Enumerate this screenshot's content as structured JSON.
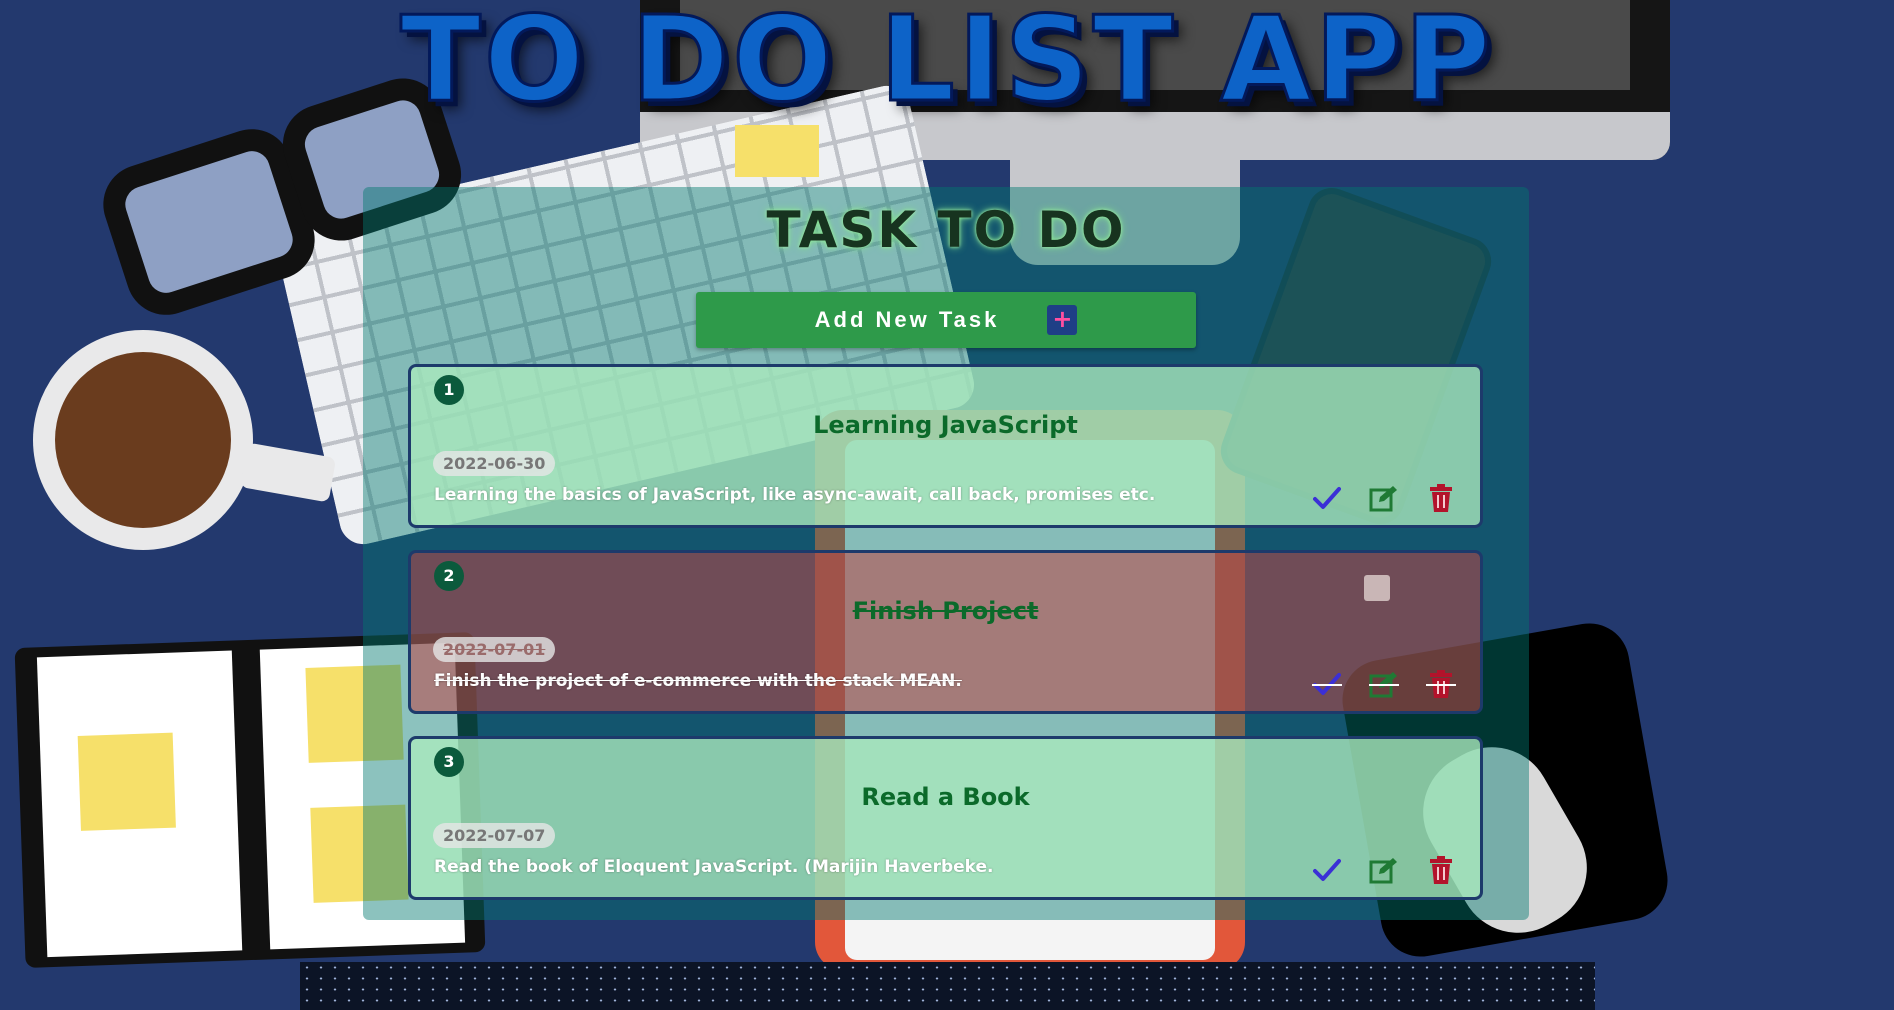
{
  "app": {
    "title": "TO DO LIST APP"
  },
  "panel": {
    "title": "TASK TO DO",
    "add_button_label": "Add New Task",
    "add_icon": "plus-icon"
  },
  "tasks": [
    {
      "number": "1",
      "title": "Learning JavaScript",
      "date": "2022-06-30",
      "description": "Learning the basics of JavaScript, like async-await, call back, promises etc.",
      "completed": false
    },
    {
      "number": "2",
      "title": "Finish Project",
      "date": "2022-07-01",
      "description": "Finish the project of e-commerce with the stack MEAN.",
      "completed": true
    },
    {
      "number": "3",
      "title": "Read a Book",
      "date": "2022-07-07",
      "description": "Read the book of Eloquent JavaScript. (Marijin Haverbeke.",
      "completed": false
    }
  ],
  "icons": {
    "complete": "check-icon",
    "edit": "edit-icon",
    "delete": "trash-icon"
  },
  "colors": {
    "background": "#23396e",
    "title_blue": "#0d63c8",
    "add_button": "#2e9a4a",
    "check": "#3b2fd6",
    "edit": "#1f7a34",
    "delete": "#b3132b"
  }
}
